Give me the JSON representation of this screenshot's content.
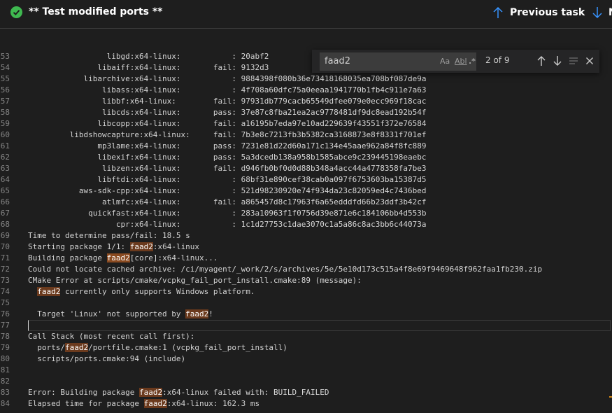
{
  "header": {
    "status_icon": "check-circle-icon",
    "task_title": "** Test modified ports **",
    "prev_label": "Previous task",
    "next_label_visible": "N"
  },
  "find": {
    "query": "faad2",
    "match_count": "2 of 9",
    "options": {
      "match_case": "Aa",
      "whole_word": "Abl",
      "regex": ".*"
    }
  },
  "log": [
    {
      "n": "53",
      "parts": [
        {
          "t": "                 libgd:x64-linux:           : 20abf2"
        }
      ]
    },
    {
      "n": "54",
      "parts": [
        {
          "t": "               libaiff:x64-linux:       fail: 9132d3"
        }
      ]
    },
    {
      "n": "55",
      "parts": [
        {
          "t": "            libarchive:x64-linux:           : 9884398f080b36e73418168035ea708bf087de9a"
        }
      ]
    },
    {
      "n": "56",
      "parts": [
        {
          "t": "                libass:x64-linux:           : 4f708a60dfc75a0eeaa1941770b1fb4c911e7a63"
        }
      ]
    },
    {
      "n": "57",
      "parts": [
        {
          "t": "                libbf:x64-linux:        fail: 97931db779cacb65549dfee079e0ecc969f18cac"
        }
      ]
    },
    {
      "n": "58",
      "parts": [
        {
          "t": "                libcds:x64-linux:       pass: 37e87c8fba21ea2ac9778481df9dc8ead192b54f"
        }
      ]
    },
    {
      "n": "59",
      "parts": [
        {
          "t": "               libcopp:x64-linux:       fail: a16195b7eda97e10ad229639f43551f372e76584"
        }
      ]
    },
    {
      "n": "60",
      "parts": [
        {
          "t": "         libdshowcapture:x64-linux:     fail: 7b3e8c7213fb3b5382ca3168873e8f8331f701ef"
        }
      ]
    },
    {
      "n": "61",
      "parts": [
        {
          "t": "               mp3lame:x64-linux:       pass: 7231e81d22d60a171c134e45aae962a84f8fc889"
        }
      ]
    },
    {
      "n": "62",
      "parts": [
        {
          "t": "               libexif:x64-linux:       pass: 5a3dcedb138a958b1585abce9c239445198eaebc"
        }
      ]
    },
    {
      "n": "63",
      "parts": [
        {
          "t": "                libzen:x64-linux:       fail: d946fb0bf0d0d88b348a4acc44a4778358fa7be3"
        }
      ]
    },
    {
      "n": "64",
      "parts": [
        {
          "t": "               libftdi:x64-linux:           : 68bf31e890cef38cab0a097f6753603ba15387d5"
        }
      ]
    },
    {
      "n": "65",
      "parts": [
        {
          "t": "           aws-sdk-cpp:x64-linux:           : 521d98230920e74f934da23c82059ed4c7436bed"
        }
      ]
    },
    {
      "n": "66",
      "parts": [
        {
          "t": "                atlmfc:x64-linux:       fail: a865457d8c17963f6a65edddfd66b23ddf3b42cf"
        }
      ]
    },
    {
      "n": "67",
      "parts": [
        {
          "t": "             quickfast:x64-linux:           : 283a10963f1f0756d39e871e6c184106bb4d553b"
        }
      ]
    },
    {
      "n": "68",
      "parts": [
        {
          "t": "                   cpr:x64-linux:           : 1c1d27753c1dae3070c1a5a86c8ac3bb6c44073a"
        }
      ]
    },
    {
      "n": "69",
      "parts": [
        {
          "t": "Time to determine pass/fail: 18.5 s"
        }
      ]
    },
    {
      "n": "70",
      "parts": [
        {
          "t": "Starting package 1/1: "
        },
        {
          "t": "faad2",
          "h": 1
        },
        {
          "t": ":x64-linux"
        }
      ]
    },
    {
      "n": "71",
      "parts": [
        {
          "t": "Building package "
        },
        {
          "t": "faad2",
          "h": 2
        },
        {
          "t": "[core]:x64-linux..."
        }
      ]
    },
    {
      "n": "72",
      "parts": [
        {
          "t": "Could not locate cached archive: /ci/myagent/_work/2/s/archives/5e/5e10d173c515a4f8e69f9469648f962faa1fb230.zip"
        }
      ]
    },
    {
      "n": "73",
      "parts": [
        {
          "t": "CMake Error at scripts/cmake/vcpkg_fail_port_install.cmake:89 (message):"
        }
      ]
    },
    {
      "n": "74",
      "parts": [
        {
          "t": "  "
        },
        {
          "t": "faad2",
          "h": 1
        },
        {
          "t": " currently only supports Windows platform."
        }
      ]
    },
    {
      "n": "75",
      "parts": [
        {
          "t": ""
        }
      ]
    },
    {
      "n": "76",
      "parts": [
        {
          "t": "  Target 'Linux' not supported by "
        },
        {
          "t": "faad2",
          "h": 1
        },
        {
          "t": "!"
        }
      ]
    },
    {
      "n": "77",
      "parts": [
        {
          "t": ""
        }
      ],
      "cursor": true
    },
    {
      "n": "78",
      "parts": [
        {
          "t": "Call Stack (most recent call first):"
        }
      ]
    },
    {
      "n": "79",
      "parts": [
        {
          "t": "  ports/"
        },
        {
          "t": "faad2",
          "h": 1
        },
        {
          "t": "/portfile.cmake:1 (vcpkg_fail_port_install)"
        }
      ]
    },
    {
      "n": "80",
      "parts": [
        {
          "t": "  scripts/ports.cmake:94 (include)"
        }
      ]
    },
    {
      "n": "81",
      "parts": [
        {
          "t": ""
        }
      ]
    },
    {
      "n": "82",
      "parts": [
        {
          "t": ""
        }
      ]
    },
    {
      "n": "83",
      "parts": [
        {
          "t": "Error: Building package "
        },
        {
          "t": "faad2",
          "h": 1
        },
        {
          "t": ":x64-linux failed with: BUILD_FAILED"
        }
      ]
    },
    {
      "n": "84",
      "parts": [
        {
          "t": "Elapsed time for package "
        },
        {
          "t": "faad2",
          "h": 1
        },
        {
          "t": ":x64-linux: 162.3 ms"
        }
      ]
    }
  ]
}
